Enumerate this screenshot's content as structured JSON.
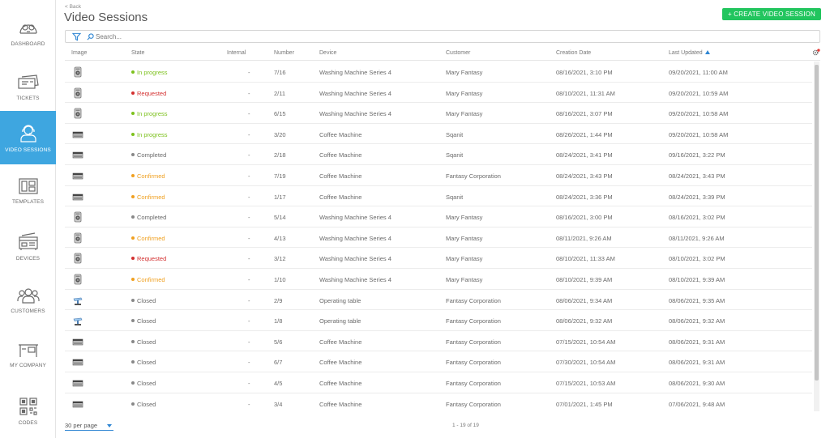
{
  "sidebar": {
    "items": [
      {
        "label": "DASHBOARD",
        "icon": "dashboard-icon"
      },
      {
        "label": "TICKETS",
        "icon": "tickets-icon"
      },
      {
        "label": "VIDEO SESSIONS",
        "icon": "video-sessions-icon",
        "active": true
      },
      {
        "label": "TEMPLATES",
        "icon": "templates-icon"
      },
      {
        "label": "DEVICES",
        "icon": "devices-icon"
      },
      {
        "label": "CUSTOMERS",
        "icon": "customers-icon"
      },
      {
        "label": "MY COMPANY",
        "icon": "my-company-icon"
      },
      {
        "label": "CODES",
        "icon": "codes-icon"
      }
    ],
    "active_color": "#3ea6e0"
  },
  "header": {
    "back_label": "< Back",
    "title": "Video Sessions",
    "create_button_label": "+ CREATE VIDEO SESSION",
    "create_button_color": "#22c55e"
  },
  "search": {
    "placeholder": "Search..."
  },
  "table": {
    "columns": [
      "Image",
      "State",
      "Internal",
      "Number",
      "Device",
      "Customer",
      "Creation Date",
      "Last Updated"
    ],
    "sorted_column": "Last Updated",
    "sort_direction": "ascending",
    "state_colors": {
      "In progress": "#7cc11c",
      "Requested": "#d32f2f",
      "Completed": "#888888",
      "Confirmed": "#f0a020",
      "Closed": "#888888"
    },
    "rows": [
      {
        "image": "washing-machine-icon",
        "state": "In progress",
        "internal": "-",
        "number": "7/16",
        "device": "Washing Machine Series 4",
        "customer": "Mary Fantasy",
        "created": "08/16/2021, 3:10 PM",
        "updated": "09/20/2021, 11:00 AM"
      },
      {
        "image": "washing-machine-icon",
        "state": "Requested",
        "internal": "-",
        "number": "2/11",
        "device": "Washing Machine Series 4",
        "customer": "Mary Fantasy",
        "created": "08/10/2021, 11:31 AM",
        "updated": "09/20/2021, 10:59 AM"
      },
      {
        "image": "washing-machine-icon",
        "state": "In progress",
        "internal": "-",
        "number": "6/15",
        "device": "Washing Machine Series 4",
        "customer": "Mary Fantasy",
        "created": "08/16/2021, 3:07 PM",
        "updated": "09/20/2021, 10:58 AM"
      },
      {
        "image": "coffee-machine-icon",
        "state": "In progress",
        "internal": "-",
        "number": "3/20",
        "device": "Coffee Machine",
        "customer": "Sqanit",
        "created": "08/26/2021, 1:44 PM",
        "updated": "09/20/2021, 10:58 AM"
      },
      {
        "image": "coffee-machine-icon",
        "state": "Completed",
        "internal": "-",
        "number": "2/18",
        "device": "Coffee Machine",
        "customer": "Sqanit",
        "created": "08/24/2021, 3:41 PM",
        "updated": "09/16/2021, 3:22 PM"
      },
      {
        "image": "coffee-machine-icon",
        "state": "Confirmed",
        "internal": "-",
        "number": "7/19",
        "device": "Coffee Machine",
        "customer": "Fantasy Corporation",
        "created": "08/24/2021, 3:43 PM",
        "updated": "08/24/2021, 3:43 PM"
      },
      {
        "image": "coffee-machine-icon",
        "state": "Confirmed",
        "internal": "-",
        "number": "1/17",
        "device": "Coffee Machine",
        "customer": "Sqanit",
        "created": "08/24/2021, 3:36 PM",
        "updated": "08/24/2021, 3:39 PM"
      },
      {
        "image": "washing-machine-icon",
        "state": "Completed",
        "internal": "-",
        "number": "5/14",
        "device": "Washing Machine Series 4",
        "customer": "Mary Fantasy",
        "created": "08/16/2021, 3:00 PM",
        "updated": "08/16/2021, 3:02 PM"
      },
      {
        "image": "washing-machine-icon",
        "state": "Confirmed",
        "internal": "-",
        "number": "4/13",
        "device": "Washing Machine Series 4",
        "customer": "Mary Fantasy",
        "created": "08/11/2021, 9:26 AM",
        "updated": "08/11/2021, 9:26 AM"
      },
      {
        "image": "washing-machine-icon",
        "state": "Requested",
        "internal": "-",
        "number": "3/12",
        "device": "Washing Machine Series 4",
        "customer": "Mary Fantasy",
        "created": "08/10/2021, 11:33 AM",
        "updated": "08/10/2021, 3:02 PM"
      },
      {
        "image": "washing-machine-icon",
        "state": "Confirmed",
        "internal": "-",
        "number": "1/10",
        "device": "Washing Machine Series 4",
        "customer": "Mary Fantasy",
        "created": "08/10/2021, 9:39 AM",
        "updated": "08/10/2021, 9:39 AM"
      },
      {
        "image": "operating-table-icon",
        "state": "Closed",
        "internal": "-",
        "number": "2/9",
        "device": "Operating table",
        "customer": "Fantasy Corporation",
        "created": "08/06/2021, 9:34 AM",
        "updated": "08/06/2021, 9:35 AM"
      },
      {
        "image": "operating-table-icon",
        "state": "Closed",
        "internal": "-",
        "number": "1/8",
        "device": "Operating table",
        "customer": "Fantasy Corporation",
        "created": "08/06/2021, 9:32 AM",
        "updated": "08/06/2021, 9:32 AM"
      },
      {
        "image": "coffee-machine-icon",
        "state": "Closed",
        "internal": "-",
        "number": "5/6",
        "device": "Coffee Machine",
        "customer": "Fantasy Corporation",
        "created": "07/15/2021, 10:54 AM",
        "updated": "08/06/2021, 9:31 AM"
      },
      {
        "image": "coffee-machine-icon",
        "state": "Closed",
        "internal": "-",
        "number": "6/7",
        "device": "Coffee Machine",
        "customer": "Fantasy Corporation",
        "created": "07/30/2021, 10:54 AM",
        "updated": "08/06/2021, 9:31 AM"
      },
      {
        "image": "coffee-machine-icon",
        "state": "Closed",
        "internal": "-",
        "number": "4/5",
        "device": "Coffee Machine",
        "customer": "Fantasy Corporation",
        "created": "07/15/2021, 10:53 AM",
        "updated": "08/06/2021, 9:30 AM"
      },
      {
        "image": "coffee-machine-icon",
        "state": "Closed",
        "internal": "-",
        "number": "3/4",
        "device": "Coffee Machine",
        "customer": "Fantasy Corporation",
        "created": "07/01/2021, 1:45 PM",
        "updated": "07/06/2021, 9:48 AM"
      }
    ]
  },
  "footer": {
    "per_page": "30 per page",
    "pagination": "1 - 19 of 19"
  }
}
